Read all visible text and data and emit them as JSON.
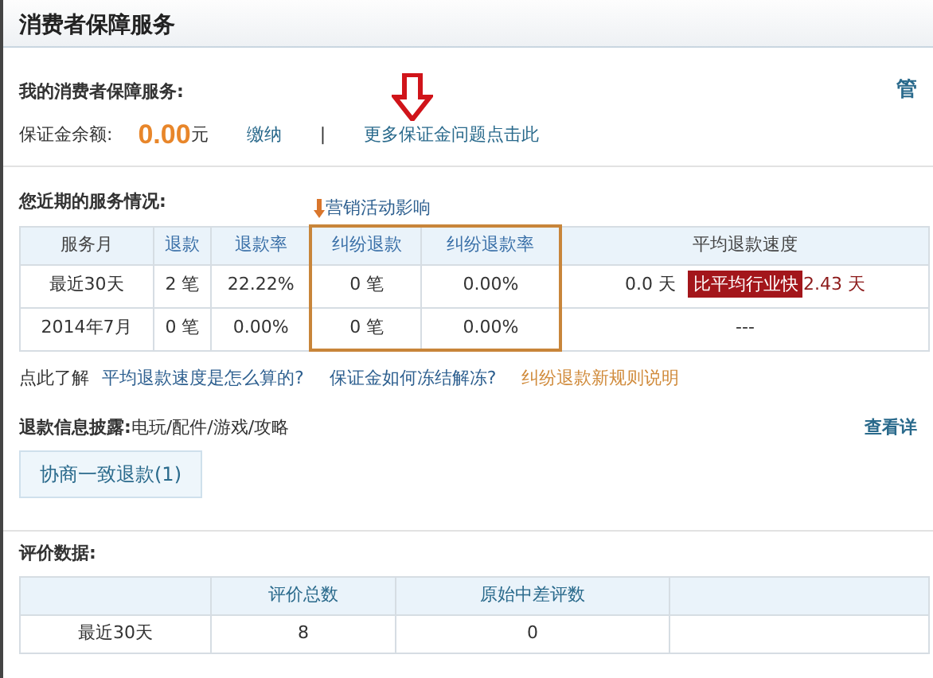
{
  "header": {
    "title": "消费者保障服务"
  },
  "guarantee": {
    "heading": "我的消费者保障服务:",
    "side_link": "管",
    "balance_label": "保证金余额:",
    "amount": "0.00",
    "unit": "元",
    "pay_link": "缴纳",
    "separator": "|",
    "more_link": "更多保证金问题点击此"
  },
  "service": {
    "heading": "您近期的服务情况:",
    "annotation": "营销活动影响",
    "columns": [
      {
        "label": "服务月",
        "link": false,
        "highlighted": false
      },
      {
        "label": "退款",
        "link": true,
        "highlighted": false
      },
      {
        "label": "退款率",
        "link": true,
        "highlighted": false
      },
      {
        "label": "纠纷退款",
        "link": true,
        "highlighted": true
      },
      {
        "label": "纠纷退款率",
        "link": true,
        "highlighted": true
      },
      {
        "label": "平均退款速度",
        "link": false,
        "highlighted": false
      }
    ],
    "rows": [
      {
        "cells": [
          "最近30天",
          "2 笔",
          "22.22%",
          "0 笔",
          "0.00%"
        ],
        "speed": {
          "kind": "compare",
          "value": "0.0 天",
          "badge": "比平均行业快",
          "diff": "2.43 天"
        }
      },
      {
        "cells": [
          "2014年7月",
          "0 笔",
          "0.00%",
          "0 笔",
          "0.00%"
        ],
        "speed": {
          "kind": "text",
          "value": "---"
        }
      }
    ]
  },
  "help": {
    "label": "点此了解",
    "links": [
      {
        "text": "平均退款速度是怎么算的?",
        "kind": "normal"
      },
      {
        "text": "保证金如何冻结解冻?",
        "kind": "normal"
      },
      {
        "text": "纠纷退款新规则说明",
        "kind": "notice"
      }
    ]
  },
  "refund_info": {
    "label": "退款信息披露:",
    "categories": "电玩/配件/游戏/攻略",
    "details_link": "查看详"
  },
  "tabs": [
    {
      "label": "协商一致退款(1)",
      "selected": true
    }
  ],
  "rating": {
    "heading": "评价数据:",
    "columns": [
      "评价总数",
      "原始中差评数"
    ],
    "rows": [
      {
        "period": "最近30天",
        "values": [
          "8",
          "0"
        ]
      }
    ]
  }
}
